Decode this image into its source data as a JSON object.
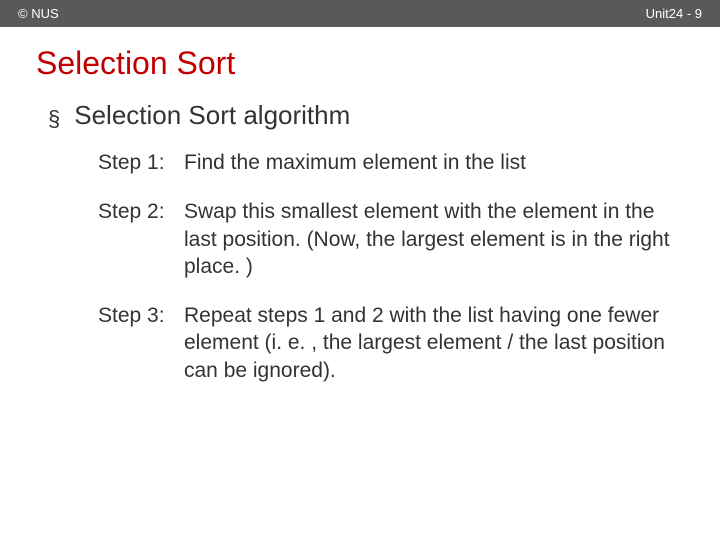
{
  "header": {
    "left": "© NUS",
    "right": "Unit24 - 9"
  },
  "title": "Selection Sort",
  "bullet": {
    "symbol": "§",
    "text": "Selection Sort algorithm"
  },
  "steps": [
    {
      "label": "Step 1:",
      "text": "Find the maximum element in the list"
    },
    {
      "label": "Step 2:",
      "text": "Swap this smallest element with the element in the last position. (Now, the largest element is in the right place. )"
    },
    {
      "label": "Step 3:",
      "text": "Repeat steps 1 and 2 with the list having one fewer element (i. e. , the largest element / the last position can be ignored)."
    }
  ]
}
